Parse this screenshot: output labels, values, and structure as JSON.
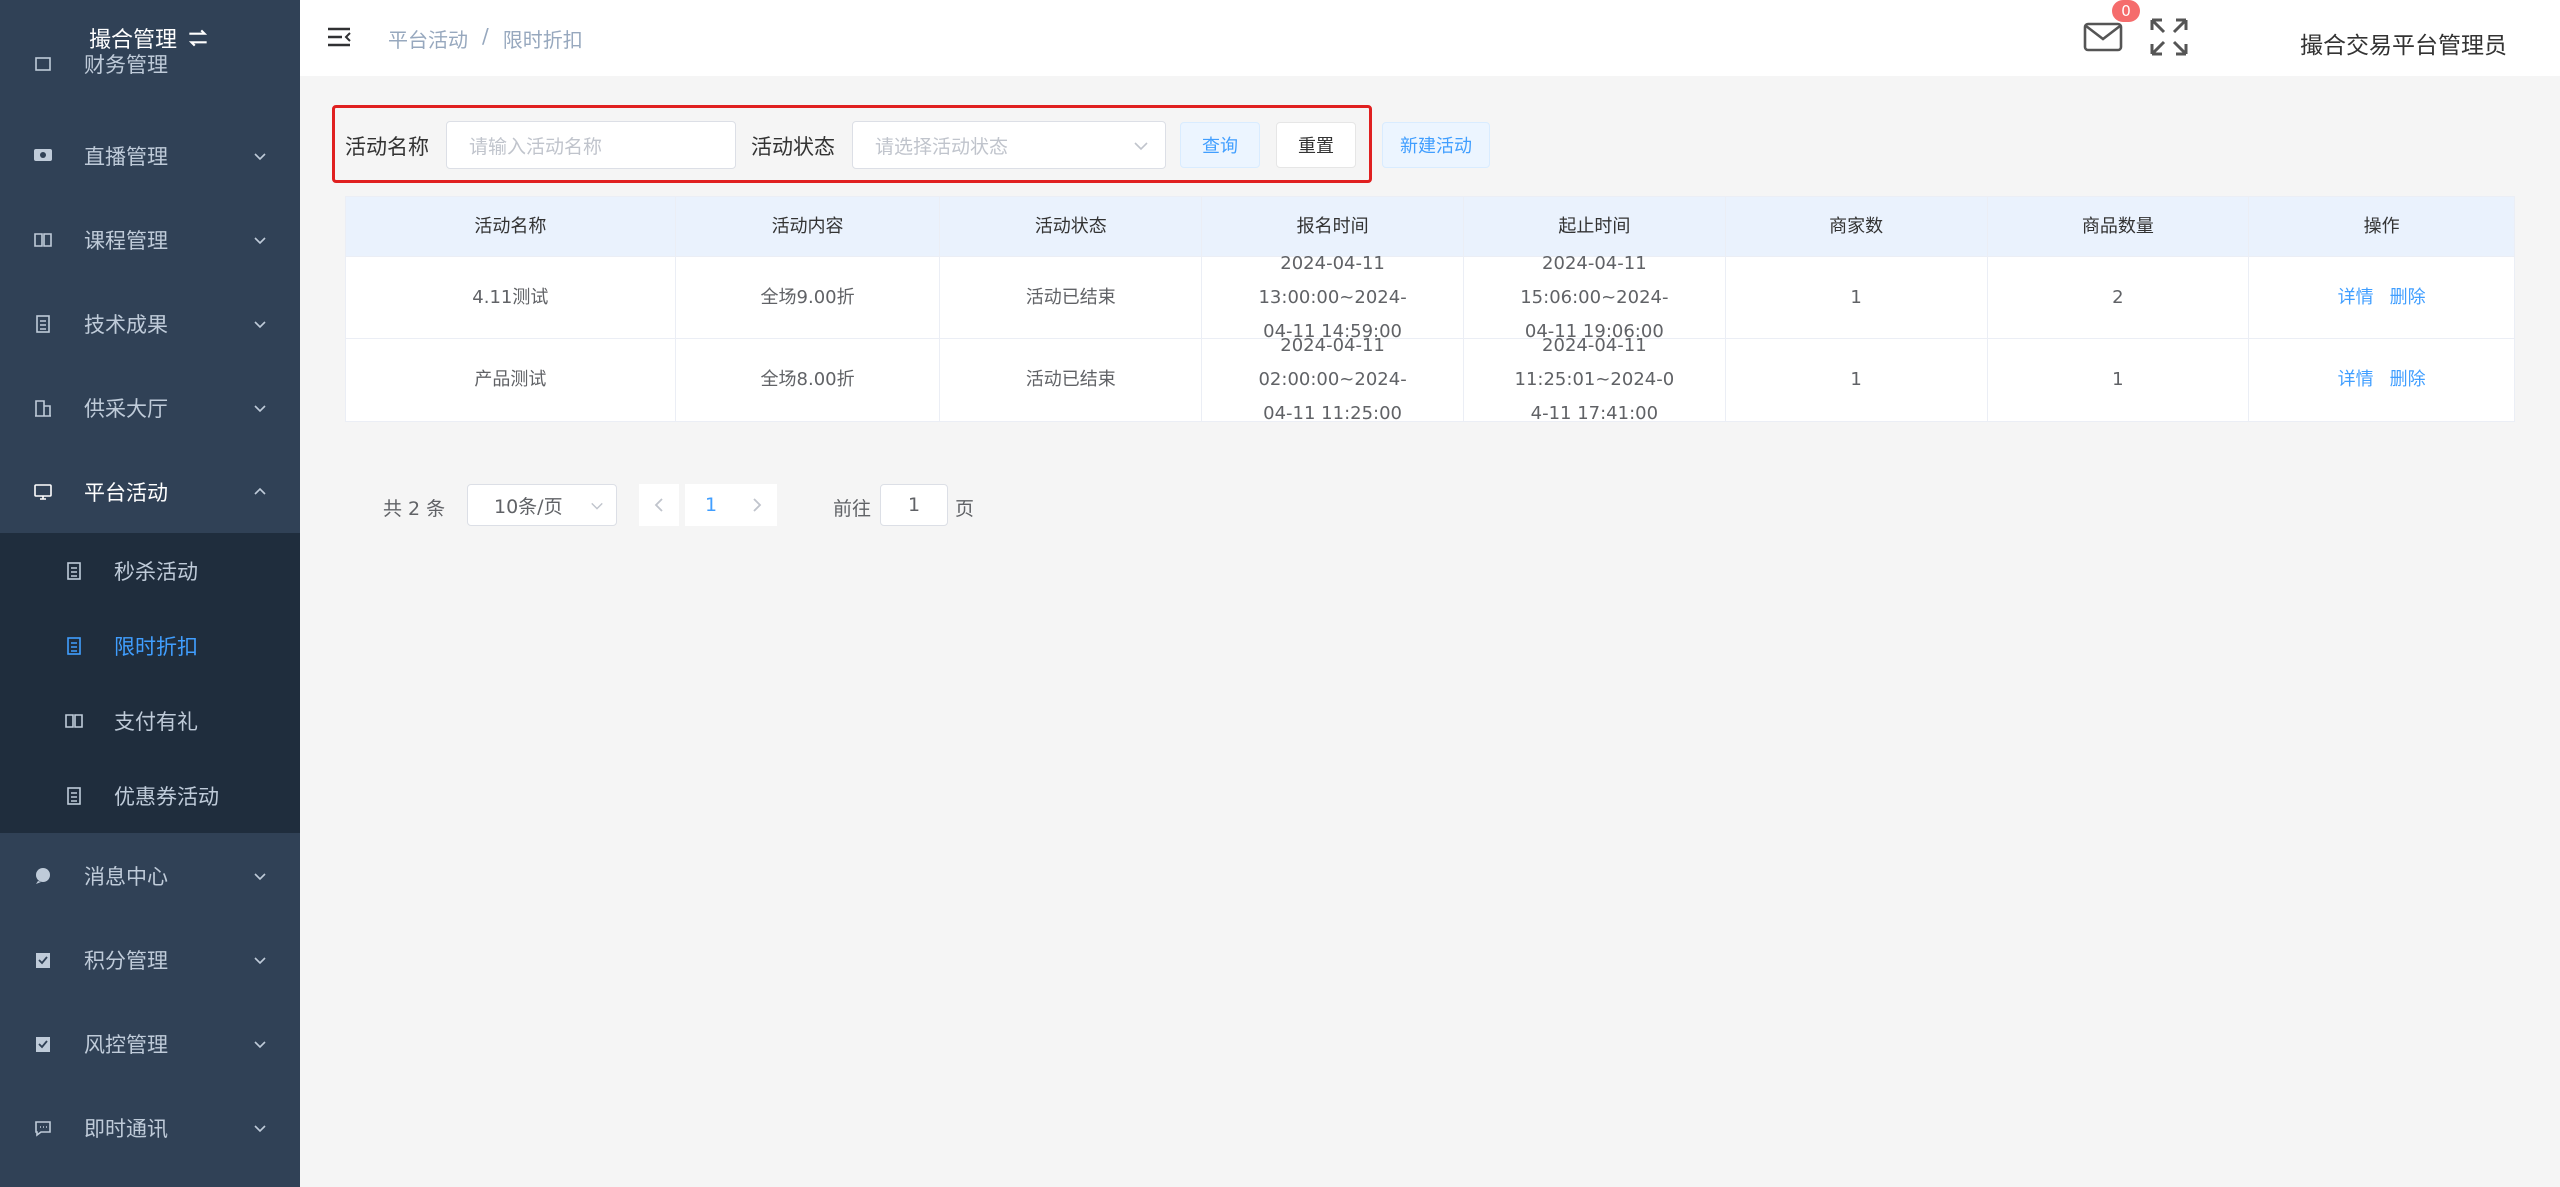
{
  "app": {
    "title": "撮合管理"
  },
  "sidebar": {
    "items": [
      {
        "label": "财务管理",
        "icon": "money-icon"
      },
      {
        "label": "直播管理",
        "icon": "monitor-icon"
      },
      {
        "label": "课程管理",
        "icon": "book-icon"
      },
      {
        "label": "技术成果",
        "icon": "document-icon"
      },
      {
        "label": "供采大厅",
        "icon": "building-icon"
      },
      {
        "label": "平台活动",
        "icon": "screen-icon"
      },
      {
        "label": "消息中心",
        "icon": "chat-icon"
      },
      {
        "label": "积分管理",
        "icon": "clipboard-icon"
      },
      {
        "label": "风控管理",
        "icon": "clipboard-icon"
      },
      {
        "label": "即时通讯",
        "icon": "message-icon"
      }
    ],
    "sub_items": [
      {
        "label": "秒杀活动"
      },
      {
        "label": "限时折扣"
      },
      {
        "label": "支付有礼"
      },
      {
        "label": "优惠券活动"
      }
    ]
  },
  "header": {
    "breadcrumb": [
      "平台活动",
      "限时折扣"
    ],
    "breadcrumb_sep": "/",
    "mail_badge": "0",
    "username": "撮合交易平台管理员"
  },
  "search": {
    "name_label": "活动名称",
    "name_placeholder": "请输入活动名称",
    "status_label": "活动状态",
    "status_placeholder": "请选择活动状态",
    "query_label": "查询",
    "reset_label": "重置",
    "new_label": "新建活动"
  },
  "table": {
    "columns": [
      "活动名称",
      "活动内容",
      "活动状态",
      "报名时间",
      "起止时间",
      "商家数",
      "商品数量",
      "操作"
    ],
    "rows": [
      {
        "name": "4.11测试",
        "content": "全场9.00折",
        "status": "活动已结束",
        "signup_1": "2024-04-11 13:00:00~2024-",
        "signup_2": "04-11 14:59:00",
        "period_1": "2024-04-11 15:06:00~2024-",
        "period_2": "04-11 19:06:00",
        "merchants": "1",
        "products": "2",
        "detail": "详情",
        "delete": "删除"
      },
      {
        "name": "产品测试",
        "content": "全场8.00折",
        "status": "活动已结束",
        "signup_1": "2024-04-11 02:00:00~2024-",
        "signup_2": "04-11 11:25:00",
        "period_1": "2024-04-11 11:25:01~2024-0",
        "period_2": "4-11 17:41:00",
        "merchants": "1",
        "products": "1",
        "detail": "详情",
        "delete": "删除"
      }
    ]
  },
  "pagination": {
    "total": "共 2 条",
    "page_size": "10条/页",
    "current": "1",
    "goto_label": "前往",
    "goto_value": "1",
    "unit": "页"
  },
  "colors": {
    "sidebar_bg": "#304156",
    "submenu_bg": "#1f2d3d",
    "accent": "#409eff",
    "highlight_border": "#e02020"
  }
}
